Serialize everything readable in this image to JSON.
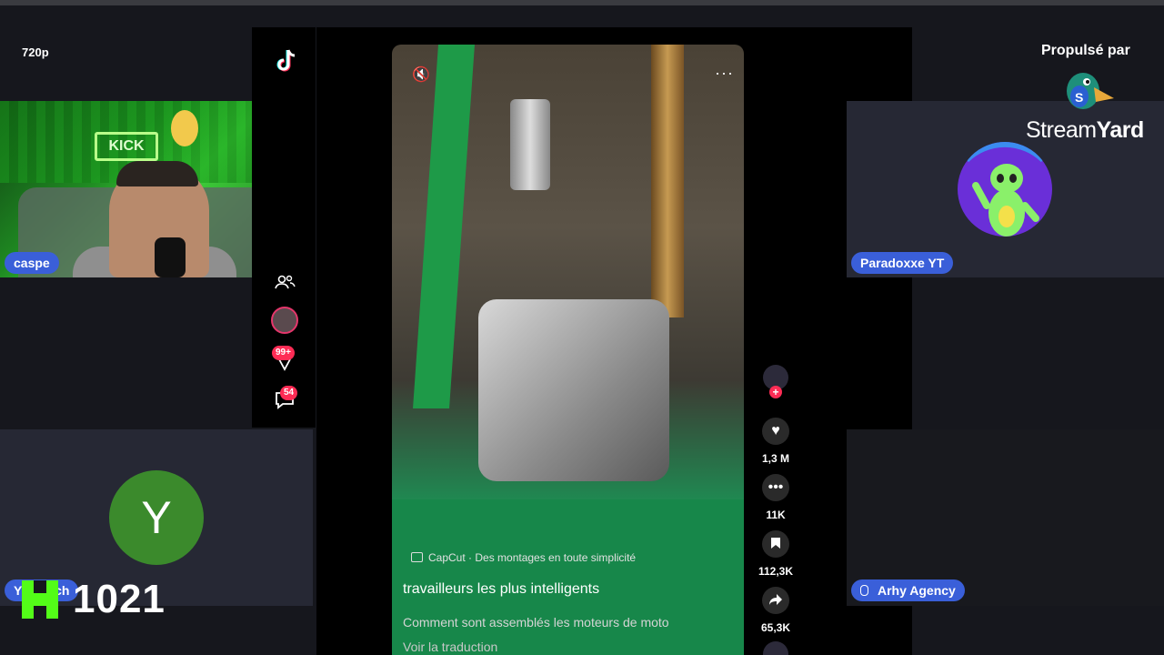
{
  "stream": {
    "quality": "720p"
  },
  "participants": {
    "host": {
      "name": "caspe"
    },
    "bottom_left": {
      "initial": "Y",
      "name": "Yazoutch"
    },
    "top_right": {
      "name": "Paradoxxe YT"
    },
    "bottom_right": {
      "name": "Arhy Agency"
    }
  },
  "kick": {
    "count": "1021"
  },
  "branding": {
    "powered_by": "Propulsé par",
    "name_light": "Stream",
    "name_bold": "Yard"
  },
  "tiktok": {
    "notifications_badge": "99+",
    "messages_badge": "54",
    "video": {
      "capcut_label": "CapCut · Des montages en toute simplicité",
      "title": "travailleurs les plus intelligents",
      "description": "Comment sont assemblés les moteurs de moto",
      "translate": "Voir la traduction",
      "likes": "1,3 M",
      "comments": "11K",
      "saves": "112,3K",
      "shares": "65,3K"
    }
  },
  "colors": {
    "name_badge": "#3a5fd9",
    "kick_green": "#53fc18",
    "tiktok_red": "#fe2c55"
  }
}
